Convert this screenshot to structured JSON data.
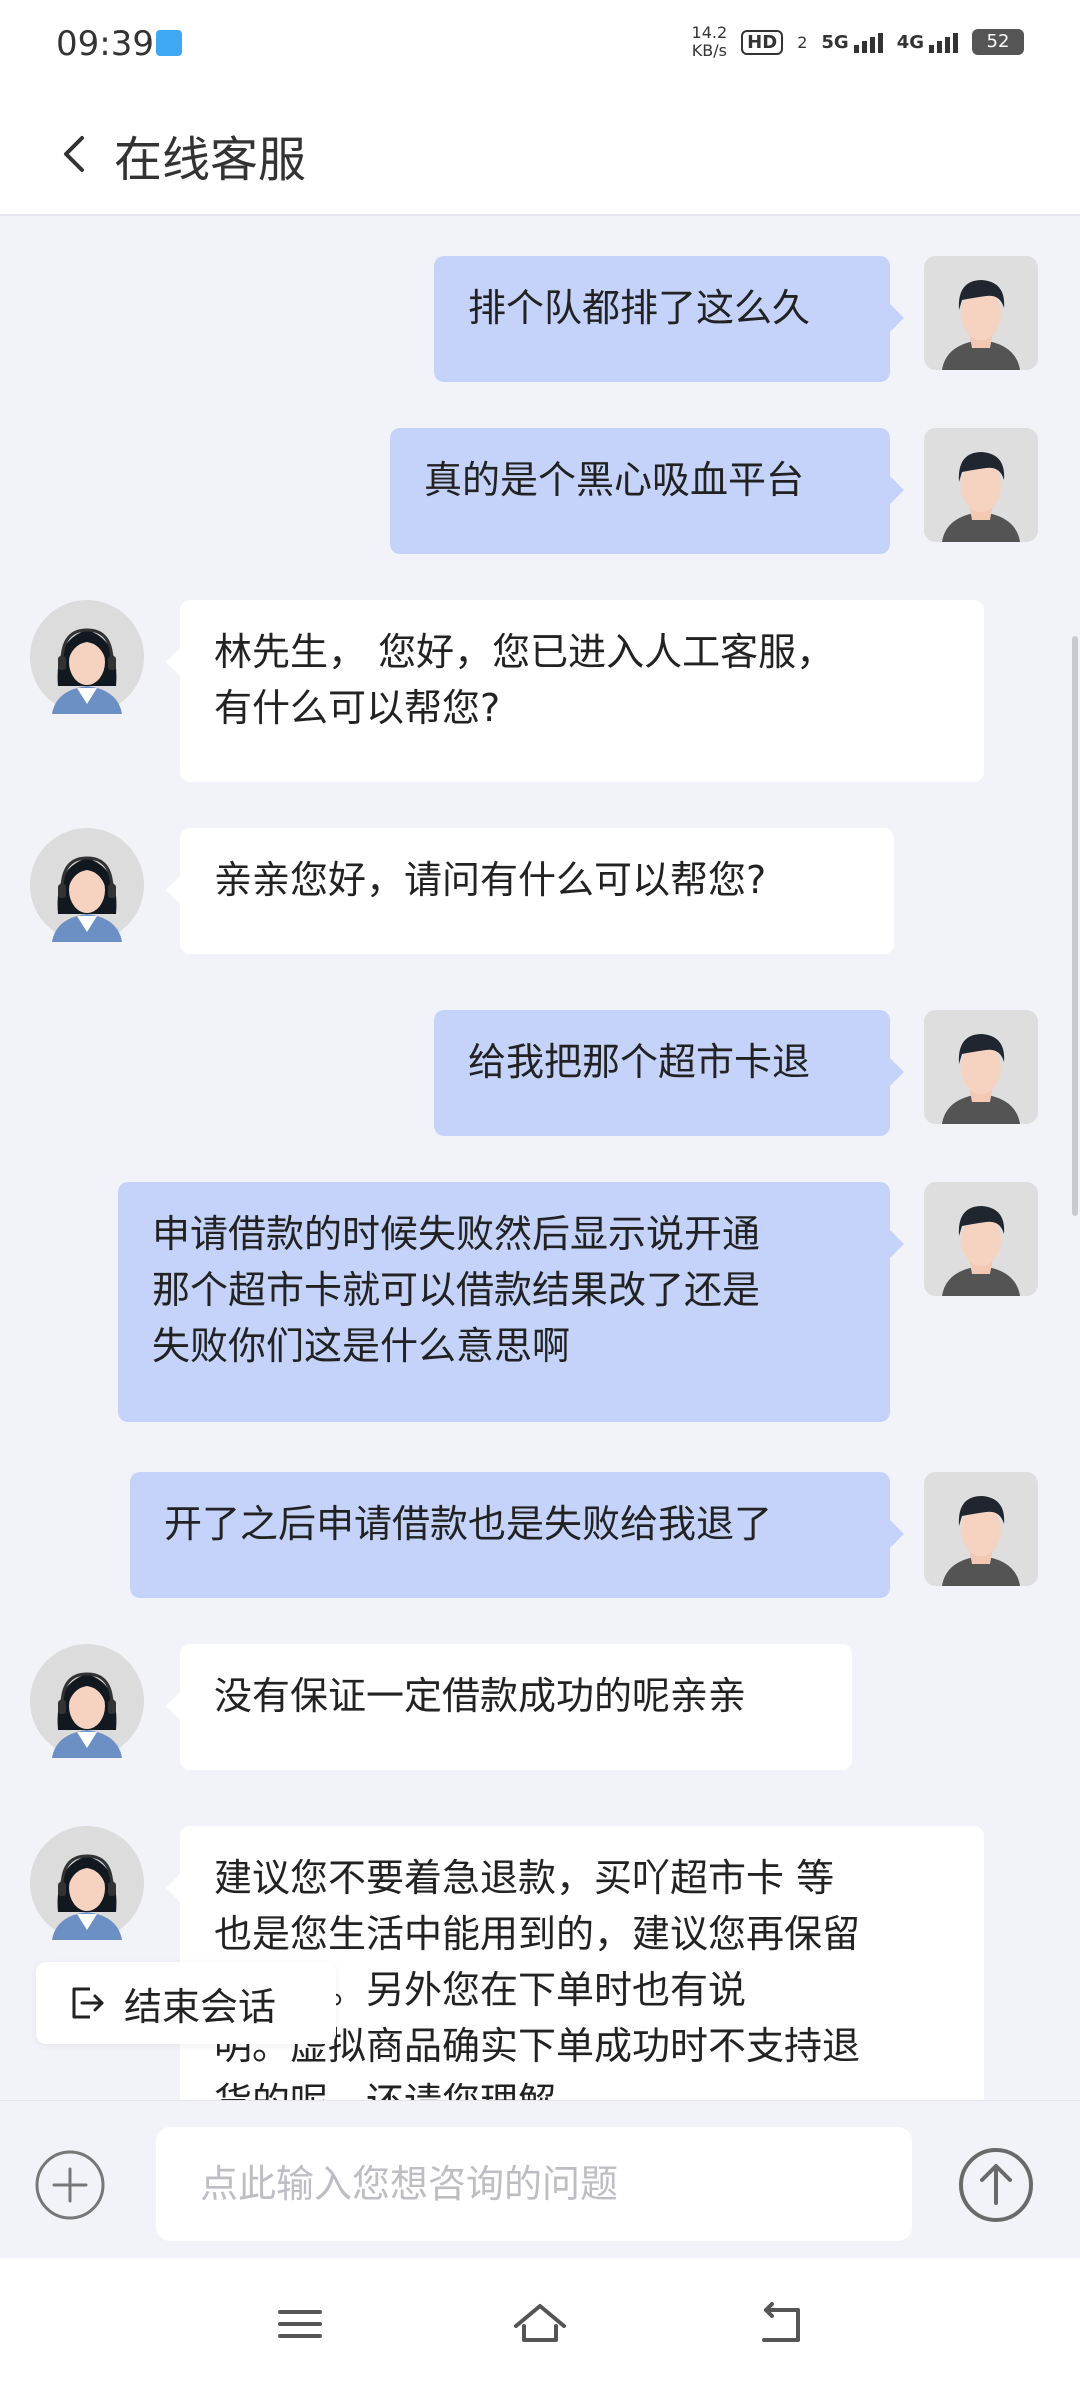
{
  "status_bar": {
    "time": "09:39",
    "net_speed_value": "14.2",
    "net_speed_unit": "KB/s",
    "hd_label": "HD",
    "sim_number": "2",
    "signal1_label": "5G",
    "signal2_label": "4G",
    "battery": "52"
  },
  "header": {
    "title": "在线客服"
  },
  "messages": [
    {
      "from": "user",
      "text": "排个队都排了这么久"
    },
    {
      "from": "user",
      "text": "真的是个黑心吸血平台"
    },
    {
      "from": "agent",
      "text": "林先生， 您好，您已进入人工客服，\n有什么可以帮您?"
    },
    {
      "from": "agent",
      "text": "亲亲您好，请问有什么可以帮您?"
    },
    {
      "from": "user",
      "text": "给我把那个超市卡退"
    },
    {
      "from": "user",
      "text": "申请借款的时候失败然后显示说开通\n那个超市卡就可以借款结果改了还是\n失败你们这是什么意思啊"
    },
    {
      "from": "user",
      "text": "开了之后申请借款也是失败给我退了"
    },
    {
      "from": "agent",
      "text": "没有保证一定借款成功的呢亲亲"
    },
    {
      "from": "agent",
      "text": "建议您不要着急退款，买吖超市卡 等\n也是您生活中能用到的，建议您再保留\n看看呢。另外您在下单时也有说\n明。虚拟商品确实下单成功时不支持退\n货的呢，还请您理解"
    }
  ],
  "end_chat": {
    "label": "结束会话"
  },
  "input": {
    "placeholder": "点此输入您想咨询的问题"
  },
  "colors": {
    "user_bubble": "#c5d3fb",
    "agent_bubble": "#ffffff",
    "page_bg": "#f2f3f8"
  }
}
